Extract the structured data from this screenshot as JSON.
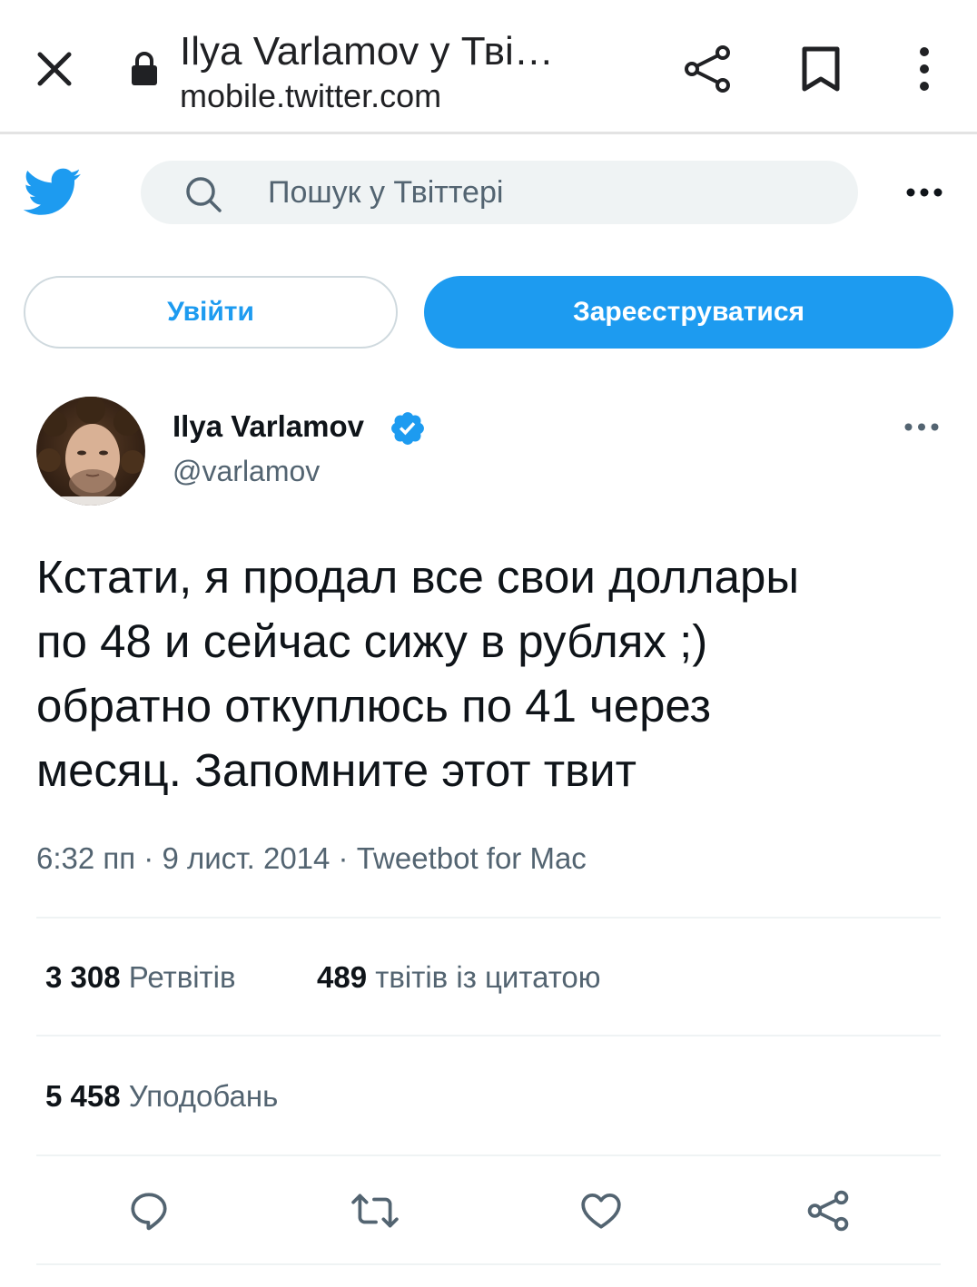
{
  "browser": {
    "title": "Ilya Varlamov у Тві…",
    "url": "mobile.twitter.com"
  },
  "topbar": {
    "search_placeholder": "Пошук у Твіттері"
  },
  "auth": {
    "login_label": "Увійти",
    "signup_label": "Зареєструватися"
  },
  "tweet": {
    "author": {
      "display_name": "Ilya Varlamov",
      "username": "@varlamov",
      "verified": true
    },
    "text": "Кстати, я продал все свои доллары\nпо 48 и сейчас сижу в рублях ;)\nобратно откуплюсь по 41 через\nмесяц. Запомните этот твит",
    "meta": "6:32 пп · 9 лист. 2014 · Tweetbot for Mac",
    "stats": {
      "retweets_count": "3 308",
      "retweets_label": "Ретвітів",
      "quotes_count": "489",
      "quotes_label": "твітів із цитатою",
      "likes_count": "5 458",
      "likes_label": "Уподобань"
    }
  },
  "icons": {
    "close": "close-icon",
    "lock": "lock-icon",
    "share": "share-icon",
    "bookmark": "bookmark-icon",
    "menu": "vertical-dots-icon",
    "twitter": "twitter-bird-icon",
    "search": "search-icon",
    "more": "horizontal-dots-icon",
    "verified": "verified-badge-icon",
    "reply": "reply-icon",
    "retweet": "retweet-icon",
    "like": "heart-icon",
    "tweet_share": "share-icon"
  },
  "colors": {
    "accent": "#1d9bf0",
    "text_primary": "#0f1419",
    "text_secondary": "#536471",
    "divider": "#eff3f4",
    "search_bg": "#eff3f4"
  }
}
